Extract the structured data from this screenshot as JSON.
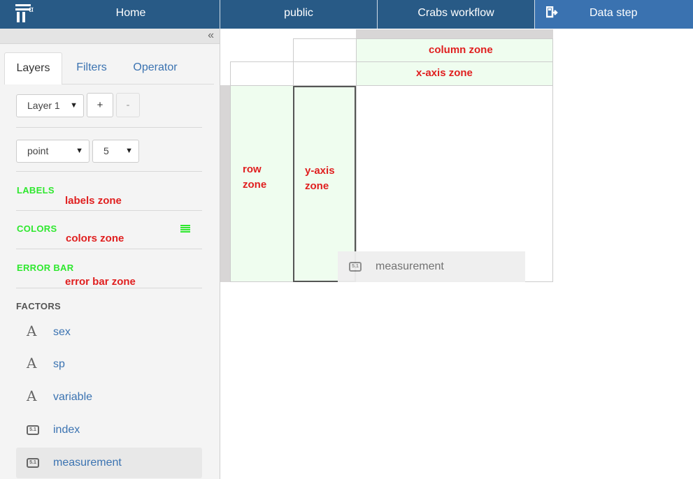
{
  "topbar": {
    "nav": [
      "Home",
      "public",
      "Crabs workflow",
      "Data step"
    ],
    "logo_alpha": "α"
  },
  "sidebar": {
    "collapse": "«",
    "tabs": [
      "Layers",
      "Filters",
      "Operator"
    ],
    "layer_select": "Layer 1",
    "add": "+",
    "remove": "-",
    "geom_select": "point",
    "size_select": "5",
    "sections": {
      "labels": "LABELS",
      "labels_zone": "labels zone",
      "colors": "COLORS",
      "colors_zone": "colors zone",
      "error_bar": "ERROR BAR",
      "error_bar_zone": "error bar zone"
    },
    "factors_title": "FACTORS",
    "factors": [
      {
        "name": "sex",
        "type": "text"
      },
      {
        "name": "sp",
        "type": "text"
      },
      {
        "name": "variable",
        "type": "text"
      },
      {
        "name": "index",
        "type": "numeric"
      },
      {
        "name": "measurement",
        "type": "numeric"
      }
    ],
    "numeric_icon_text": "5.1",
    "text_icon_text": "A"
  },
  "plot": {
    "column_zone": "column zone",
    "xaxis_zone": "x-axis zone",
    "row_zone_1": "row",
    "row_zone_2": "zone",
    "yaxis_zone_1": "y-axis",
    "yaxis_zone_2": "zone"
  },
  "drag": {
    "label": "measurement"
  }
}
